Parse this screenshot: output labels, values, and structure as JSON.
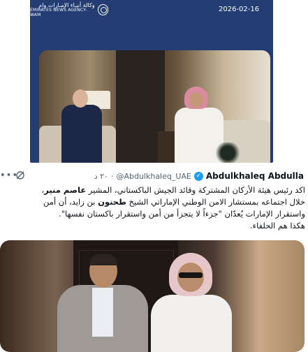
{
  "news_card": {
    "logo_arabic": "وكالة أنبـاء الإمـارات وام",
    "logo_english": "EMIRATES NEWS AGENCY-WAM",
    "date": "2026-02-16",
    "background_color": "#233d72"
  },
  "tweet": {
    "author_name": "Abdulkhaleq Abdulla",
    "verified": true,
    "handle": "@Abdulkhaleq_UAE",
    "time": "٢٠ د",
    "separator": "·",
    "more_icon": "more-horizontal-icon",
    "grok_icon": "grok-icon",
    "body": {
      "line1_pre": "اكد رئيس هيئة الأركان المشتركة وقائد الجيش الباكستاني، المشير ",
      "line1_bold": "عاصم منير",
      "line1_post": "،",
      "line2_pre": "خلال اجتماعه بمستشار الامن الوطني الإماراتي الشيخ ",
      "line2_bold": "طحنون",
      "line2_post": " بن زايد،  أن أمن",
      "line3": "واستقرار الإمارات يُعدّان \"جزءاً لا يتجزأ من أمن واستقرار باكستان نفسها\".",
      "line4": "هكذا هم الحلفاء."
    },
    "accent_color": "#1d9bf0"
  }
}
